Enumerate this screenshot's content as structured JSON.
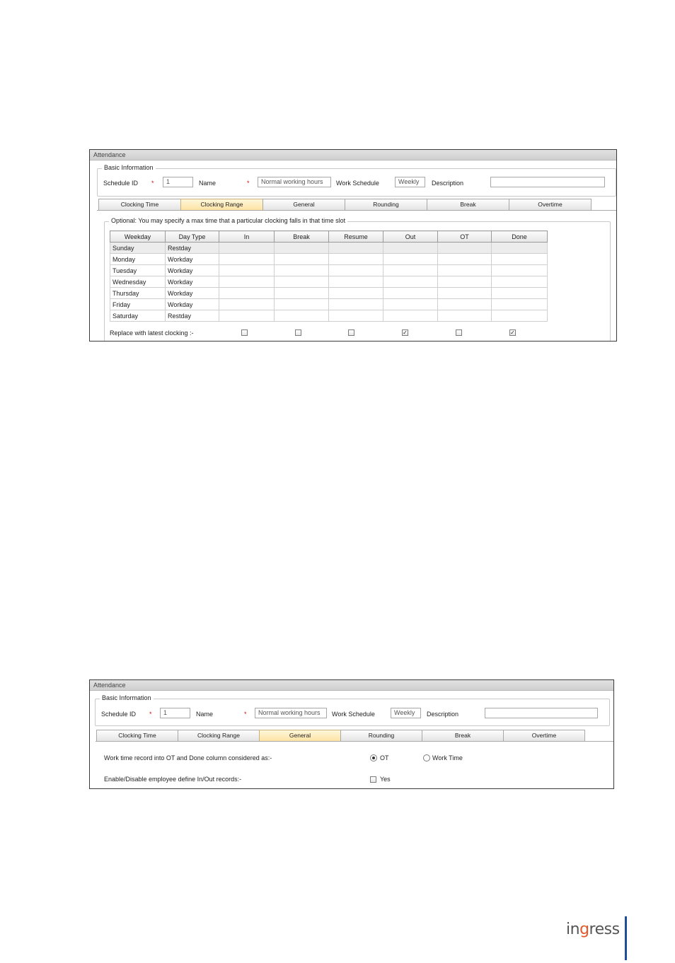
{
  "window1": {
    "title": "Attendance",
    "basic_info": {
      "legend": "Basic Information",
      "schedule_id_label": "Schedule ID",
      "schedule_id_value": "1",
      "name_label": "Name",
      "name_value": "Normal working hours",
      "work_schedule_label": "Work Schedule",
      "work_schedule_value": "Weekly",
      "description_label": "Description",
      "description_value": "",
      "required_mark": "*"
    },
    "tabs": [
      "Clocking Time",
      "Clocking Range",
      "General",
      "Rounding",
      "Break",
      "Overtime"
    ],
    "active_tab": "Clocking Range",
    "optional_legend": "Optional: You may specify a max time that a particular clocking falls in that time slot",
    "columns": [
      "Weekday",
      "Day Type",
      "In",
      "Break",
      "Resume",
      "Out",
      "OT",
      "Done"
    ],
    "rows": [
      [
        "Sunday",
        "Restday"
      ],
      [
        "Monday",
        "Workday"
      ],
      [
        "Tuesday",
        "Workday"
      ],
      [
        "Wednesday",
        "Workday"
      ],
      [
        "Thursday",
        "Workday"
      ],
      [
        "Friday",
        "Workday"
      ],
      [
        "Saturday",
        "Restday"
      ]
    ],
    "replace_label": "Replace with latest clocking :-",
    "replace_checks": [
      false,
      false,
      false,
      true,
      false,
      true
    ]
  },
  "window2": {
    "title": "Attendance",
    "basic_info": {
      "legend": "Basic Information",
      "schedule_id_label": "Schedule ID",
      "schedule_id_value": "1",
      "name_label": "Name",
      "name_value": "Normal working hours",
      "work_schedule_label": "Work Schedule",
      "work_schedule_value": "Weekly",
      "description_label": "Description",
      "description_value": "",
      "required_mark": "*"
    },
    "tabs": [
      "Clocking Time",
      "Clocking Range",
      "General",
      "Rounding",
      "Break",
      "Overtime"
    ],
    "active_tab": "General",
    "work_time_label": "Work time record into OT and Done column considered as:-",
    "radio_ot_label": "OT",
    "radio_worktime_label": "Work Time",
    "radio_selected": "OT",
    "enable_label": "Enable/Disable employee define In/Out records:-",
    "enable_yes_label": "Yes",
    "enable_checked": false
  },
  "footer": {
    "logo_text_1": "in",
    "logo_text_accent": "g",
    "logo_text_2": "ress",
    "accent_color": "#e2582a",
    "bar_color": "#1d4e9c"
  }
}
